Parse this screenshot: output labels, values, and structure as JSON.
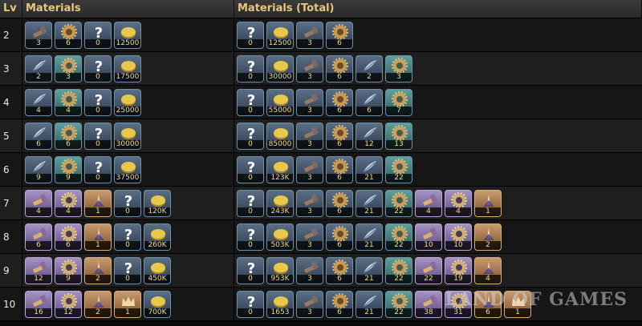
{
  "headers": {
    "lv": "Lv",
    "materials": "Materials",
    "total": "Materials (Total)"
  },
  "watermark": "LAND OF GAMES",
  "rows": [
    {
      "lv": "2",
      "materials": [
        {
          "icon": "hammer-icon",
          "type": "hammer",
          "qty": "3"
        },
        {
          "icon": "gear-icon",
          "type": "gear",
          "qty": "6"
        },
        {
          "icon": "question-icon",
          "type": "q",
          "qty": "0"
        },
        {
          "icon": "gold-coin-icon",
          "type": "gold",
          "qty": "12500"
        }
      ],
      "total": [
        {
          "icon": "question-icon",
          "type": "q",
          "qty": "0"
        },
        {
          "icon": "gold-coin-icon",
          "type": "gold",
          "qty": "12500"
        },
        {
          "icon": "hammer-icon",
          "type": "hammer",
          "qty": "3"
        },
        {
          "icon": "gear-icon",
          "type": "gear",
          "qty": "6"
        }
      ]
    },
    {
      "lv": "3",
      "materials": [
        {
          "icon": "feather-icon",
          "type": "feather",
          "qty": "2"
        },
        {
          "icon": "gear-icon",
          "type": "lav2",
          "qty": "3"
        },
        {
          "icon": "question-icon",
          "type": "q",
          "qty": "0"
        },
        {
          "icon": "gold-coin-icon",
          "type": "gold",
          "qty": "17500"
        }
      ],
      "total": [
        {
          "icon": "question-icon",
          "type": "q",
          "qty": "0"
        },
        {
          "icon": "gold-coin-icon",
          "type": "gold",
          "qty": "30000"
        },
        {
          "icon": "hammer-icon",
          "type": "hammer",
          "qty": "3"
        },
        {
          "icon": "gear-icon",
          "type": "gear",
          "qty": "6"
        },
        {
          "icon": "feather-icon",
          "type": "feather",
          "qty": "2"
        },
        {
          "icon": "gear-icon",
          "type": "lav2",
          "qty": "3"
        }
      ]
    },
    {
      "lv": "4",
      "materials": [
        {
          "icon": "feather-icon",
          "type": "feather",
          "qty": "4"
        },
        {
          "icon": "gear-icon",
          "type": "lav2",
          "qty": "4"
        },
        {
          "icon": "question-icon",
          "type": "q",
          "qty": "0"
        },
        {
          "icon": "gold-coin-icon",
          "type": "gold",
          "qty": "25000"
        }
      ],
      "total": [
        {
          "icon": "question-icon",
          "type": "q",
          "qty": "0"
        },
        {
          "icon": "gold-coin-icon",
          "type": "gold",
          "qty": "55000"
        },
        {
          "icon": "hammer-icon",
          "type": "hammer",
          "qty": "3"
        },
        {
          "icon": "gear-icon",
          "type": "gear",
          "qty": "6"
        },
        {
          "icon": "feather-icon",
          "type": "feather",
          "qty": "6"
        },
        {
          "icon": "gear-icon",
          "type": "lav2",
          "qty": "7"
        }
      ]
    },
    {
      "lv": "5",
      "materials": [
        {
          "icon": "feather-icon",
          "type": "feather",
          "qty": "6"
        },
        {
          "icon": "gear-icon",
          "type": "lav2",
          "qty": "6"
        },
        {
          "icon": "question-icon",
          "type": "q",
          "qty": "0"
        },
        {
          "icon": "gold-coin-icon",
          "type": "gold",
          "qty": "30000"
        }
      ],
      "total": [
        {
          "icon": "question-icon",
          "type": "q",
          "qty": "0"
        },
        {
          "icon": "gold-coin-icon",
          "type": "gold",
          "qty": "85000"
        },
        {
          "icon": "hammer-icon",
          "type": "hammer",
          "qty": "3"
        },
        {
          "icon": "gear-icon",
          "type": "gear",
          "qty": "6"
        },
        {
          "icon": "feather-icon",
          "type": "feather",
          "qty": "12"
        },
        {
          "icon": "gear-icon",
          "type": "lav2",
          "qty": "13"
        }
      ]
    },
    {
      "lv": "6",
      "materials": [
        {
          "icon": "feather-icon",
          "type": "feather",
          "qty": "9"
        },
        {
          "icon": "gear-icon",
          "type": "lav2",
          "qty": "9"
        },
        {
          "icon": "question-icon",
          "type": "q",
          "qty": "0"
        },
        {
          "icon": "gold-coin-icon",
          "type": "gold",
          "qty": "37500"
        }
      ],
      "total": [
        {
          "icon": "question-icon",
          "type": "q",
          "qty": "0"
        },
        {
          "icon": "gold-coin-icon",
          "type": "gold",
          "qty": "123K"
        },
        {
          "icon": "hammer-icon",
          "type": "hammer",
          "qty": "3"
        },
        {
          "icon": "gear-icon",
          "type": "gear",
          "qty": "6"
        },
        {
          "icon": "feather-icon",
          "type": "feather",
          "qty": "21"
        },
        {
          "icon": "gear-icon",
          "type": "lav2",
          "qty": "22"
        }
      ]
    },
    {
      "lv": "7",
      "materials": [
        {
          "icon": "hammer-icon",
          "type": "lhammer",
          "qty": "4"
        },
        {
          "icon": "gear-icon",
          "type": "lgear",
          "qty": "4"
        },
        {
          "icon": "talon-icon",
          "type": "talon",
          "qty": "1"
        },
        {
          "icon": "question-icon",
          "type": "q",
          "qty": "0"
        },
        {
          "icon": "gold-coin-icon",
          "type": "gold",
          "qty": "120K"
        }
      ],
      "total": [
        {
          "icon": "question-icon",
          "type": "q",
          "qty": "0"
        },
        {
          "icon": "gold-coin-icon",
          "type": "gold",
          "qty": "243K"
        },
        {
          "icon": "hammer-icon",
          "type": "hammer",
          "qty": "3"
        },
        {
          "icon": "gear-icon",
          "type": "gear",
          "qty": "6"
        },
        {
          "icon": "feather-icon",
          "type": "feather",
          "qty": "21"
        },
        {
          "icon": "gear-icon",
          "type": "lav2",
          "qty": "22"
        },
        {
          "icon": "hammer-icon",
          "type": "lhammer",
          "qty": "4"
        },
        {
          "icon": "gear-icon",
          "type": "lgear",
          "qty": "4"
        },
        {
          "icon": "talon-icon",
          "type": "talon",
          "qty": "1"
        }
      ]
    },
    {
      "lv": "8",
      "materials": [
        {
          "icon": "hammer-icon",
          "type": "lhammer",
          "qty": "6"
        },
        {
          "icon": "gear-icon",
          "type": "lgear",
          "qty": "6"
        },
        {
          "icon": "talon-icon",
          "type": "talon",
          "qty": "1"
        },
        {
          "icon": "question-icon",
          "type": "q",
          "qty": "0"
        },
        {
          "icon": "gold-coin-icon",
          "type": "gold",
          "qty": "260K"
        }
      ],
      "total": [
        {
          "icon": "question-icon",
          "type": "q",
          "qty": "0"
        },
        {
          "icon": "gold-coin-icon",
          "type": "gold",
          "qty": "503K"
        },
        {
          "icon": "hammer-icon",
          "type": "hammer",
          "qty": "3"
        },
        {
          "icon": "gear-icon",
          "type": "gear",
          "qty": "6"
        },
        {
          "icon": "feather-icon",
          "type": "feather",
          "qty": "21"
        },
        {
          "icon": "gear-icon",
          "type": "lav2",
          "qty": "22"
        },
        {
          "icon": "hammer-icon",
          "type": "lhammer",
          "qty": "10"
        },
        {
          "icon": "gear-icon",
          "type": "lgear",
          "qty": "10"
        },
        {
          "icon": "talon-icon",
          "type": "talon",
          "qty": "2"
        }
      ]
    },
    {
      "lv": "9",
      "materials": [
        {
          "icon": "hammer-icon",
          "type": "lhammer",
          "qty": "12"
        },
        {
          "icon": "gear-icon",
          "type": "lgear",
          "qty": "9"
        },
        {
          "icon": "talon-icon",
          "type": "talon",
          "qty": "2"
        },
        {
          "icon": "question-icon",
          "type": "q",
          "qty": "0"
        },
        {
          "icon": "gold-coin-icon",
          "type": "gold",
          "qty": "450K"
        }
      ],
      "total": [
        {
          "icon": "question-icon",
          "type": "q",
          "qty": "0"
        },
        {
          "icon": "gold-coin-icon",
          "type": "gold",
          "qty": "953K"
        },
        {
          "icon": "hammer-icon",
          "type": "hammer",
          "qty": "3"
        },
        {
          "icon": "gear-icon",
          "type": "gear",
          "qty": "6"
        },
        {
          "icon": "feather-icon",
          "type": "feather",
          "qty": "21"
        },
        {
          "icon": "gear-icon",
          "type": "lav2",
          "qty": "22"
        },
        {
          "icon": "hammer-icon",
          "type": "lhammer",
          "qty": "22"
        },
        {
          "icon": "gear-icon",
          "type": "lgear",
          "qty": "19"
        },
        {
          "icon": "talon-icon",
          "type": "talon",
          "qty": "4"
        }
      ]
    },
    {
      "lv": "10",
      "materials": [
        {
          "icon": "hammer-icon",
          "type": "lhammer",
          "qty": "16"
        },
        {
          "icon": "gear-icon",
          "type": "lgear",
          "qty": "12"
        },
        {
          "icon": "talon-icon",
          "type": "talon",
          "qty": "2"
        },
        {
          "icon": "crown-icon",
          "type": "crown",
          "qty": "1"
        },
        {
          "icon": "gold-coin-icon",
          "type": "gold",
          "qty": "700K"
        }
      ],
      "total": [
        {
          "icon": "question-icon",
          "type": "q",
          "qty": "0"
        },
        {
          "icon": "gold-coin-icon",
          "type": "gold",
          "qty": "1653"
        },
        {
          "icon": "hammer-icon",
          "type": "hammer",
          "qty": "3"
        },
        {
          "icon": "gear-icon",
          "type": "gear",
          "qty": "6"
        },
        {
          "icon": "feather-icon",
          "type": "feather",
          "qty": "21"
        },
        {
          "icon": "gear-icon",
          "type": "lav2",
          "qty": "22"
        },
        {
          "icon": "hammer-icon",
          "type": "lhammer",
          "qty": "38"
        },
        {
          "icon": "gear-icon",
          "type": "lgear",
          "qty": "31"
        },
        {
          "icon": "talon-icon",
          "type": "talon",
          "qty": "6"
        },
        {
          "icon": "crown-icon",
          "type": "crown",
          "qty": "1"
        }
      ]
    }
  ]
}
